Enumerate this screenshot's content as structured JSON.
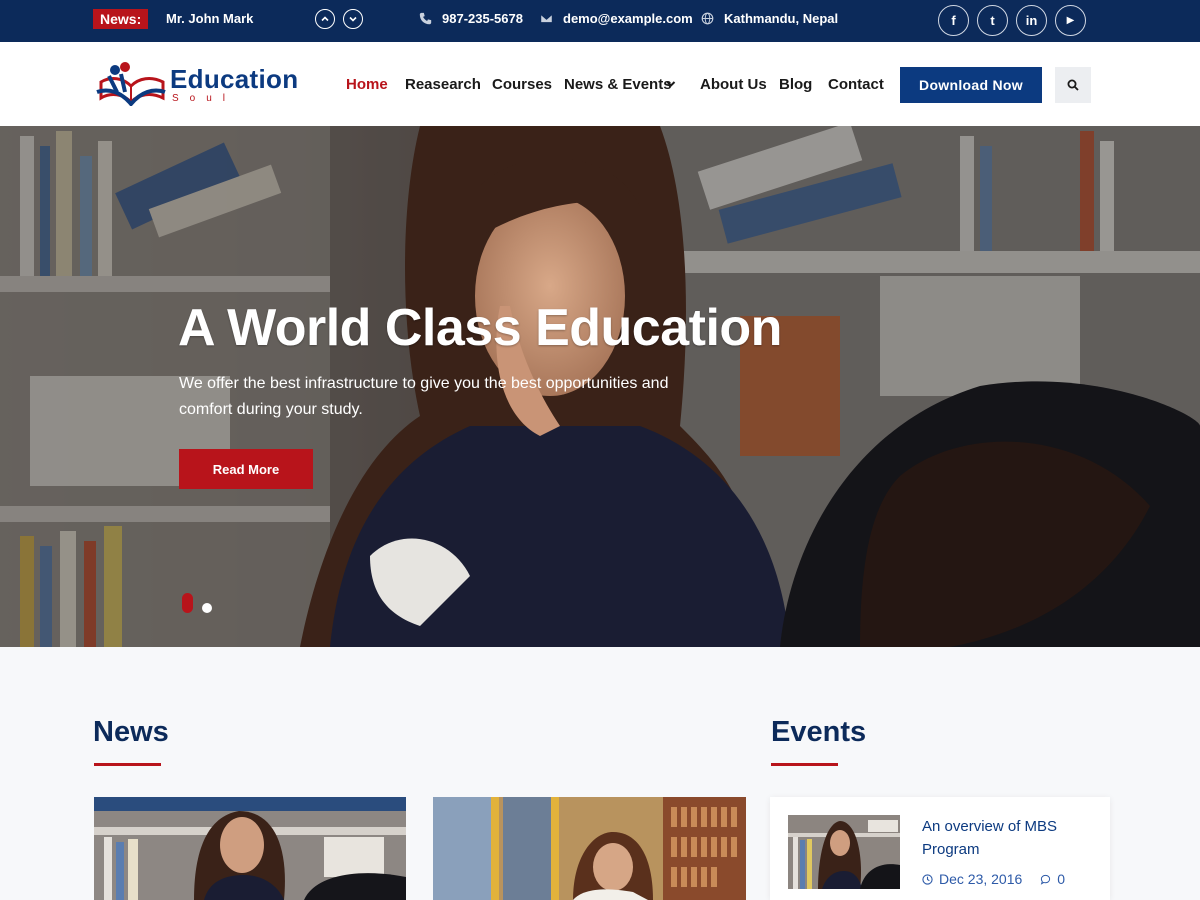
{
  "topbar": {
    "news_label": "News:",
    "news_text": "Mr. John Mark",
    "phone": "987-235-5678",
    "email": "demo@example.com",
    "location": "Kathmandu, Nepal",
    "social": [
      {
        "icon": "facebook-icon",
        "glyph": "f"
      },
      {
        "icon": "twitter-icon",
        "glyph": "t"
      },
      {
        "icon": "linkedin-icon",
        "glyph": "in"
      },
      {
        "icon": "youtube-icon",
        "glyph": "▶"
      }
    ]
  },
  "brand": {
    "title": "Education",
    "subtitle": "Soul"
  },
  "nav": {
    "items": [
      "Home",
      "Reasearch",
      "Courses",
      "News & Events",
      "About Us",
      "Blog",
      "Contact"
    ],
    "active": "Home",
    "download_label": "Download Now"
  },
  "hero": {
    "title": "A World Class Education",
    "subtitle": "We offer the best infrastructure to give you the best opportunities and comfort during your study.",
    "button_label": "Read More",
    "slide_count": 2,
    "active_slide": 1
  },
  "sections": {
    "news_title": "News",
    "events_title": "Events"
  },
  "events": [
    {
      "title": "An overview of MBS Program",
      "date": "Dec 23, 2016",
      "comments": "0"
    }
  ],
  "colors": {
    "navy": "#0c2a5a",
    "brand_blue": "#0c3a80",
    "accent_red": "#b8141b"
  }
}
